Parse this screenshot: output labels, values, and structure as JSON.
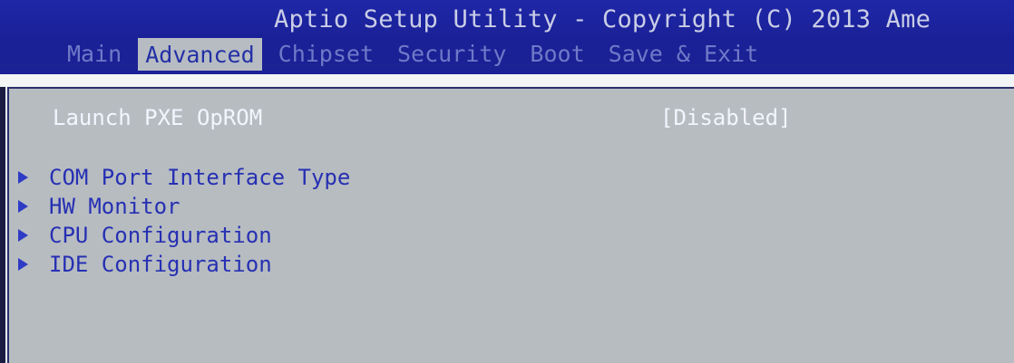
{
  "window": {
    "title": "Aptio Setup Utility - Copyright (C) 2013 Ame"
  },
  "tabs": [
    {
      "label": "Main"
    },
    {
      "label": "Advanced"
    },
    {
      "label": "Chipset"
    },
    {
      "label": "Security"
    },
    {
      "label": "Boot"
    },
    {
      "label": "Save & Exit"
    }
  ],
  "setting": {
    "label": "Launch PXE OpROM",
    "value": "[Disabled]"
  },
  "menu_items": [
    {
      "label": "COM Port Interface Type"
    },
    {
      "label": "HW Monitor"
    },
    {
      "label": "CPU Configuration"
    },
    {
      "label": "IDE Configuration"
    }
  ]
}
